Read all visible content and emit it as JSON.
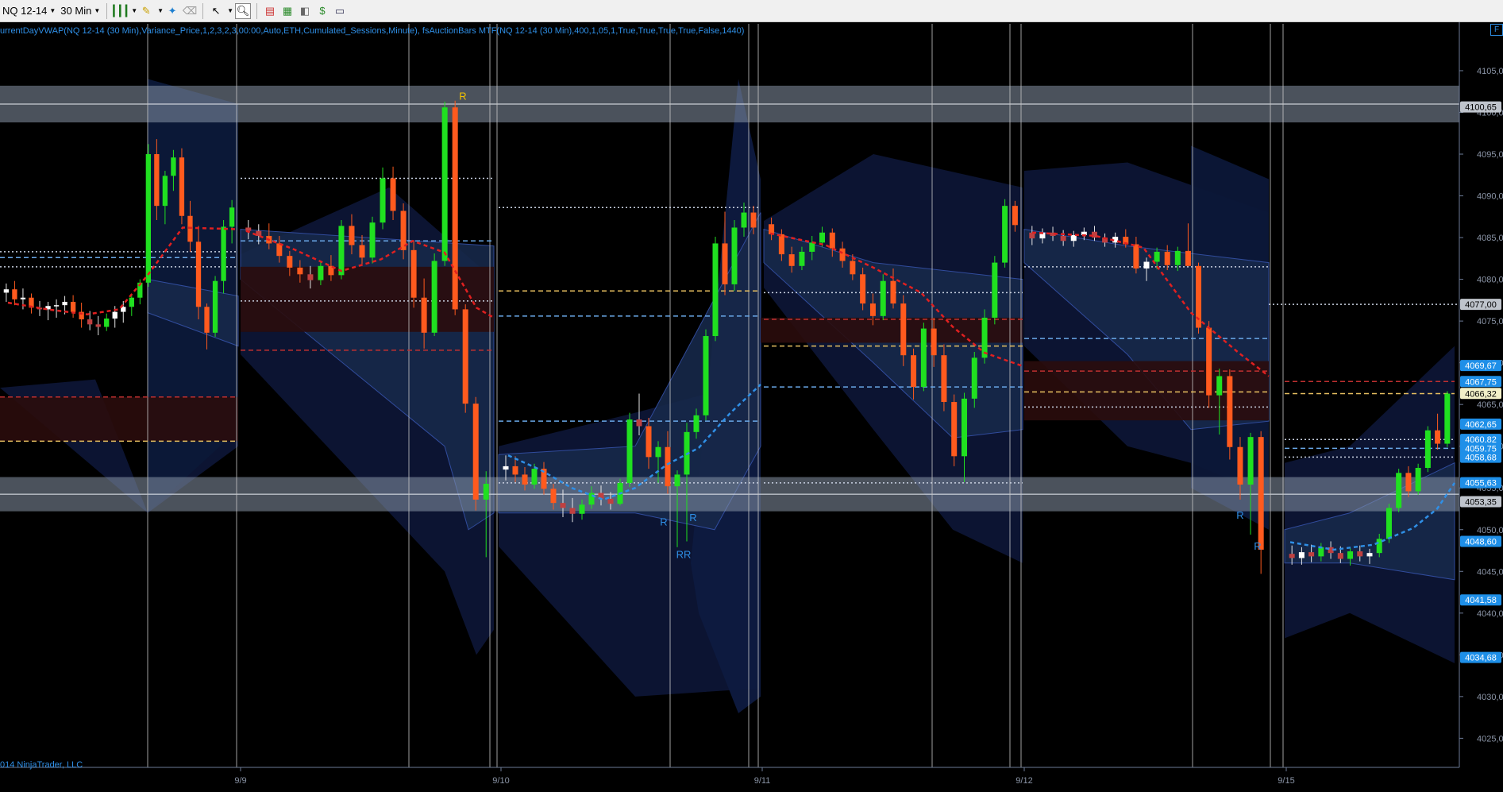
{
  "toolbar": {
    "instrument": "NQ 12-14",
    "interval": "30 Min",
    "icons": [
      "bar-style-icon",
      "pencil-draw-icon",
      "magic-wand-icon",
      "eraser-icon",
      "cursor-icon",
      "zoom-icon",
      "chart-properties-icon",
      "strategy-icon",
      "analyzer-icon",
      "data-box-icon",
      "window-icon"
    ]
  },
  "indicator_line": "urrentDayVWAP(NQ 12-14 (30 Min),Variance_Price,1,2,3,2,3,00:00,Auto,ETH,Cumulated_Sessions,Minute), fsAuctionBars MTF(NQ 12-14 (30 Min),400,1,05,1,True,True,True,True,False,1440)",
  "copyright": "014 NinjaTrader, LLC",
  "corner_tab": "F",
  "colors": {
    "background": "#000000",
    "up_candle": "#20e020",
    "down_candle": "#ff5a1e",
    "vwap_up": "#2f8fe6",
    "vwap_down": "#e02020",
    "band": "#1c2f4a",
    "zone_gray": "#8896a8",
    "label_blue": "#1e8fe8"
  },
  "chart_data": {
    "type": "candlestick",
    "instrument": "NQ 12-14",
    "interval": "30 Min",
    "y_range": [
      4022,
      4108
    ],
    "y_ticks": [
      "4105,00",
      "4100,00",
      "4095,00",
      "4090,00",
      "4085,00",
      "4080,00",
      "4075,00",
      "4070,00",
      "4065,00",
      "4060,00",
      "4055,00",
      "4050,00",
      "4045,00",
      "4040,00",
      "4035,00",
      "4030,00",
      "4025,00"
    ],
    "y_tick_values": [
      4105,
      4100,
      4095,
      4090,
      4085,
      4080,
      4075,
      4070,
      4065,
      4060,
      4055,
      4050,
      4045,
      4040,
      4035,
      4030,
      4025
    ],
    "dates": [
      "9/9",
      "9/10",
      "9/11",
      "9/12",
      "9/15"
    ],
    "price_labels": [
      {
        "text": "4100,65",
        "value": 4100.65,
        "style": "gray"
      },
      {
        "text": "4077,00",
        "value": 4077.0,
        "style": "gray"
      },
      {
        "text": "4069,67",
        "value": 4069.67,
        "style": "blue"
      },
      {
        "text": "4067,75",
        "value": 4067.75,
        "style": "blue"
      },
      {
        "text": "4066,32",
        "value": 4066.32,
        "style": "yellow"
      },
      {
        "text": "4062,65",
        "value": 4062.65,
        "style": "blue"
      },
      {
        "text": "4060,82",
        "value": 4060.82,
        "style": "blue"
      },
      {
        "text": "4059,75",
        "value": 4059.75,
        "style": "blue"
      },
      {
        "text": "4058,68",
        "value": 4058.68,
        "style": "blue"
      },
      {
        "text": "4055,63",
        "value": 4055.63,
        "style": "blue"
      },
      {
        "text": "4053,35",
        "value": 4053.35,
        "style": "gray"
      },
      {
        "text": "4048,60",
        "value": 4048.6,
        "style": "blue"
      },
      {
        "text": "4041,58",
        "value": 4041.58,
        "style": "blue"
      },
      {
        "text": "4034,68",
        "value": 4034.68,
        "style": "blue"
      }
    ],
    "r_markers": [
      "R",
      "R",
      "R",
      "RR",
      "R",
      "R"
    ],
    "zones": [
      {
        "from": 4098.8,
        "to": 4103.2,
        "kind": "resistance"
      },
      {
        "from": 4052.2,
        "to": 4056.3,
        "kind": "support"
      }
    ],
    "candles": [
      [
        4078.4,
        4079.5,
        4077.3,
        4078.8
      ],
      [
        4078.8,
        4079.8,
        4076.9,
        4077.6
      ],
      [
        4077.6,
        4078.9,
        4076.4,
        4077.8
      ],
      [
        4077.8,
        4078.3,
        4075.9,
        4076.6
      ],
      [
        4076.6,
        4077.4,
        4075.6,
        4076.4
      ],
      [
        4076.4,
        4077.3,
        4075.1,
        4076.8
      ],
      [
        4076.8,
        4077.6,
        4075.4,
        4076.9
      ],
      [
        4076.9,
        4078.0,
        4075.8,
        4077.3
      ],
      [
        4077.3,
        4078.1,
        4075.4,
        4076.1
      ],
      [
        4076.1,
        4077.2,
        4074.2,
        4075.2
      ],
      [
        4075.2,
        4076.2,
        4073.9,
        4074.6
      ],
      [
        4074.6,
        4075.6,
        4073.3,
        4074.3
      ],
      [
        4074.3,
        4075.9,
        4073.8,
        4075.3
      ],
      [
        4075.3,
        4076.8,
        4074.2,
        4076.1
      ],
      [
        4076.1,
        4077.4,
        4074.8,
        4076.7
      ],
      [
        4076.7,
        4078.2,
        4075.6,
        4077.8
      ],
      [
        4077.8,
        4080.0,
        4077.0,
        4079.6
      ],
      [
        4079.6,
        4096.2,
        4079.1,
        4095.0
      ],
      [
        4095.0,
        4096.8,
        4087.1,
        4088.8
      ],
      [
        4088.8,
        4093.0,
        4086.6,
        4092.4
      ],
      [
        4092.4,
        4095.5,
        4090.6,
        4094.6
      ],
      [
        4094.6,
        4095.7,
        4086.6,
        4087.6
      ],
      [
        4087.6,
        4089.4,
        4083.3,
        4084.5
      ],
      [
        4084.5,
        4086.4,
        4075.2,
        4076.7
      ],
      [
        4076.7,
        4077.1,
        4071.6,
        4073.6
      ],
      [
        4073.6,
        4080.4,
        4073.1,
        4079.8
      ],
      [
        4079.8,
        4087.1,
        4078.3,
        4086.3
      ],
      [
        4086.3,
        4089.5,
        4084.3,
        4088.6
      ],
      [
        4086.2,
        4087.1,
        4084.8,
        4085.8
      ],
      [
        4085.8,
        4086.6,
        4084.2,
        4085.2
      ],
      [
        4085.2,
        4086.7,
        4083.6,
        4084.3
      ],
      [
        4084.3,
        4085.2,
        4082.0,
        4082.8
      ],
      [
        4082.8,
        4083.4,
        4080.4,
        4081.4
      ],
      [
        4081.4,
        4082.3,
        4079.6,
        4080.6
      ],
      [
        4080.6,
        4081.6,
        4078.9,
        4079.9
      ],
      [
        4079.9,
        4082.2,
        4079.3,
        4081.6
      ],
      [
        4081.6,
        4082.9,
        4079.8,
        4080.5
      ],
      [
        4080.5,
        4087.1,
        4080.0,
        4086.4
      ],
      [
        4086.4,
        4087.8,
        4083.0,
        4084.1
      ],
      [
        4084.1,
        4085.3,
        4081.8,
        4082.6
      ],
      [
        4082.6,
        4087.5,
        4081.9,
        4086.8
      ],
      [
        4086.8,
        4093.4,
        4086.0,
        4092.1
      ],
      [
        4092.1,
        4093.5,
        4087.1,
        4088.2
      ],
      [
        4088.2,
        4089.1,
        4082.4,
        4083.5
      ],
      [
        4083.5,
        4084.6,
        4076.6,
        4077.8
      ],
      [
        4077.8,
        4080.1,
        4071.7,
        4073.6
      ],
      [
        4073.6,
        4083.1,
        4073.2,
        4082.2
      ],
      [
        4082.2,
        4101.3,
        4081.6,
        4100.6
      ],
      [
        4100.6,
        4101.4,
        4075.7,
        4076.4
      ],
      [
        4076.4,
        4077.0,
        4064.0,
        4065.1
      ],
      [
        4065.1,
        4065.9,
        4052.3,
        4053.6
      ],
      [
        4053.6,
        4057.0,
        4046.7,
        4055.5
      ],
      [
        4057.2,
        4058.9,
        4055.9,
        4057.6
      ],
      [
        4057.6,
        4058.8,
        4055.7,
        4056.6
      ],
      [
        4056.6,
        4057.5,
        4054.7,
        4055.4
      ],
      [
        4055.4,
        4057.9,
        4054.9,
        4057.3
      ],
      [
        4057.3,
        4058.1,
        4054.2,
        4054.9
      ],
      [
        4054.9,
        4055.5,
        4052.4,
        4053.2
      ],
      [
        4053.2,
        4054.8,
        4051.5,
        4052.6
      ],
      [
        4052.6,
        4053.8,
        4050.9,
        4051.9
      ],
      [
        4051.9,
        4053.6,
        4051.2,
        4053.0
      ],
      [
        4053.0,
        4055.2,
        4052.5,
        4054.4
      ],
      [
        4054.4,
        4055.3,
        4052.9,
        4053.7
      ],
      [
        4053.7,
        4054.5,
        4052.4,
        4053.1
      ],
      [
        4053.1,
        4056.1,
        4052.9,
        4055.6
      ],
      [
        4055.6,
        4064.0,
        4055.1,
        4063.2
      ],
      [
        4063.2,
        4066.3,
        4061.3,
        4062.4
      ],
      [
        4062.4,
        4063.4,
        4057.3,
        4058.7
      ],
      [
        4058.7,
        4060.6,
        4055.6,
        4059.9
      ],
      [
        4059.9,
        4061.8,
        4054.3,
        4055.2
      ],
      [
        4055.2,
        4057.1,
        4047.9,
        4056.6
      ],
      [
        4056.6,
        4062.8,
        4048.6,
        4061.7
      ],
      [
        4061.7,
        4064.5,
        4060.9,
        4063.7
      ],
      [
        4063.7,
        4074.0,
        4063.1,
        4073.2
      ],
      [
        4073.2,
        4085.1,
        4072.6,
        4084.3
      ],
      [
        4084.3,
        4088.1,
        4078.1,
        4079.4
      ],
      [
        4079.4,
        4087.1,
        4078.6,
        4086.2
      ],
      [
        4086.2,
        4089.2,
        4085.1,
        4088.0
      ],
      [
        4088.0,
        4088.8,
        4085.4,
        4086.2
      ],
      [
        4086.6,
        4087.4,
        4084.7,
        4085.4
      ],
      [
        4085.4,
        4086.0,
        4082.2,
        4083.0
      ],
      [
        4083.0,
        4083.9,
        4080.8,
        4081.6
      ],
      [
        4081.6,
        4083.9,
        4081.1,
        4083.3
      ],
      [
        4083.3,
        4085.2,
        4082.3,
        4084.4
      ],
      [
        4084.4,
        4086.3,
        4083.9,
        4085.6
      ],
      [
        4085.6,
        4086.1,
        4082.7,
        4083.7
      ],
      [
        4083.7,
        4084.5,
        4081.4,
        4082.2
      ],
      [
        4082.2,
        4083.0,
        4079.9,
        4080.6
      ],
      [
        4080.6,
        4081.4,
        4076.3,
        4077.1
      ],
      [
        4077.1,
        4078.3,
        4074.5,
        4075.6
      ],
      [
        4075.6,
        4080.6,
        4075.1,
        4079.8
      ],
      [
        4079.8,
        4081.3,
        4076.5,
        4077.1
      ],
      [
        4077.1,
        4078.1,
        4069.6,
        4070.9
      ],
      [
        4070.9,
        4071.7,
        4065.6,
        4067.1
      ],
      [
        4067.1,
        4074.8,
        4066.6,
        4074.1
      ],
      [
        4074.1,
        4075.4,
        4069.5,
        4070.9
      ],
      [
        4070.9,
        4072.2,
        4064.2,
        4065.3
      ],
      [
        4065.3,
        4066.2,
        4057.6,
        4058.8
      ],
      [
        4058.8,
        4066.4,
        4055.7,
        4065.7
      ],
      [
        4065.7,
        4071.3,
        4064.6,
        4070.6
      ],
      [
        4070.6,
        4076.4,
        4069.9,
        4075.4
      ],
      [
        4075.4,
        4082.8,
        4074.6,
        4082.0
      ],
      [
        4082.0,
        4089.6,
        4081.4,
        4088.8
      ],
      [
        4088.8,
        4089.4,
        4085.7,
        4086.5
      ],
      [
        4085.6,
        4086.4,
        4084.1,
        4084.9
      ],
      [
        4084.9,
        4086.1,
        4084.3,
        4085.6
      ],
      [
        4085.6,
        4086.3,
        4084.6,
        4085.2
      ],
      [
        4085.2,
        4085.9,
        4084.0,
        4084.6
      ],
      [
        4084.6,
        4085.8,
        4083.9,
        4085.3
      ],
      [
        4085.3,
        4086.2,
        4084.7,
        4085.7
      ],
      [
        4085.7,
        4086.4,
        4084.6,
        4085.0
      ],
      [
        4085.0,
        4085.5,
        4083.9,
        4084.4
      ],
      [
        4084.4,
        4085.6,
        4083.8,
        4085.1
      ],
      [
        4085.1,
        4086.0,
        4083.8,
        4084.2
      ],
      [
        4084.2,
        4085.1,
        4080.7,
        4081.3
      ],
      [
        4081.3,
        4082.6,
        4079.8,
        4082.1
      ],
      [
        4082.1,
        4083.8,
        4081.2,
        4083.3
      ],
      [
        4083.3,
        4084.1,
        4081.1,
        4081.7
      ],
      [
        4081.7,
        4083.9,
        4081.0,
        4083.4
      ],
      [
        4083.4,
        4086.7,
        4082.8,
        4081.6
      ],
      [
        4081.6,
        4082.0,
        4073.5,
        4074.2
      ],
      [
        4074.2,
        4075.0,
        4064.6,
        4066.1
      ],
      [
        4066.1,
        4069.3,
        4061.4,
        4068.4
      ],
      [
        4068.4,
        4069.2,
        4058.4,
        4059.9
      ],
      [
        4059.9,
        4061.1,
        4053.6,
        4055.4
      ],
      [
        4055.4,
        4061.6,
        4049.4,
        4061.1
      ],
      [
        4061.1,
        4061.8,
        4044.7,
        4047.6
      ],
      [
        4047.1,
        4048.1,
        4045.8,
        4046.6
      ],
      [
        4046.6,
        4047.9,
        4045.8,
        4047.3
      ],
      [
        4047.3,
        4048.2,
        4046.1,
        4046.8
      ],
      [
        4046.8,
        4048.4,
        4046.2,
        4047.9
      ],
      [
        4047.9,
        4048.6,
        4046.5,
        4047.2
      ],
      [
        4047.2,
        4048.0,
        4046.0,
        4046.5
      ],
      [
        4046.5,
        4047.8,
        4045.7,
        4047.4
      ],
      [
        4047.4,
        4048.1,
        4046.2,
        4046.8
      ],
      [
        4046.8,
        4047.7,
        4045.9,
        4047.2
      ],
      [
        4047.2,
        4049.5,
        4046.7,
        4048.9
      ],
      [
        4048.9,
        4053.1,
        4048.4,
        4052.6
      ],
      [
        4052.6,
        4057.3,
        4052.1,
        4056.8
      ],
      [
        4056.8,
        4057.6,
        4053.9,
        4054.6
      ],
      [
        4054.6,
        4057.9,
        4054.2,
        4057.4
      ],
      [
        4057.4,
        4062.4,
        4056.9,
        4061.9
      ],
      [
        4061.9,
        4063.9,
        4059.6,
        4060.3
      ],
      [
        4060.3,
        4066.6,
        4059.9,
        4066.3
      ]
    ]
  }
}
